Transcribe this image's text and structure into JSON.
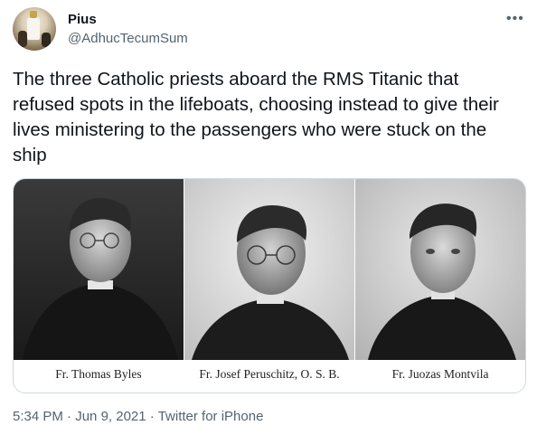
{
  "author": {
    "name": "Pius",
    "handle": "@AdhucTecumSum"
  },
  "menu_icon": "more-dots-icon",
  "tweet_text": "The three Catholic priests aboard the RMS Titanic that refused spots in the lifeboats, choosing instead to give their lives ministering to the passengers who were stuck on the ship",
  "media": {
    "captions": [
      "Fr. Thomas Byles",
      "Fr. Josef Peruschitz, O. S. B.",
      "Fr. Juozas Montvila"
    ]
  },
  "meta": {
    "time": "5:34 PM",
    "separator": " · ",
    "date": "Jun 9, 2021",
    "source": "Twitter for iPhone"
  },
  "colors": {
    "text": "#0f1419",
    "secondary": "#536471",
    "border": "#cfd9de"
  }
}
